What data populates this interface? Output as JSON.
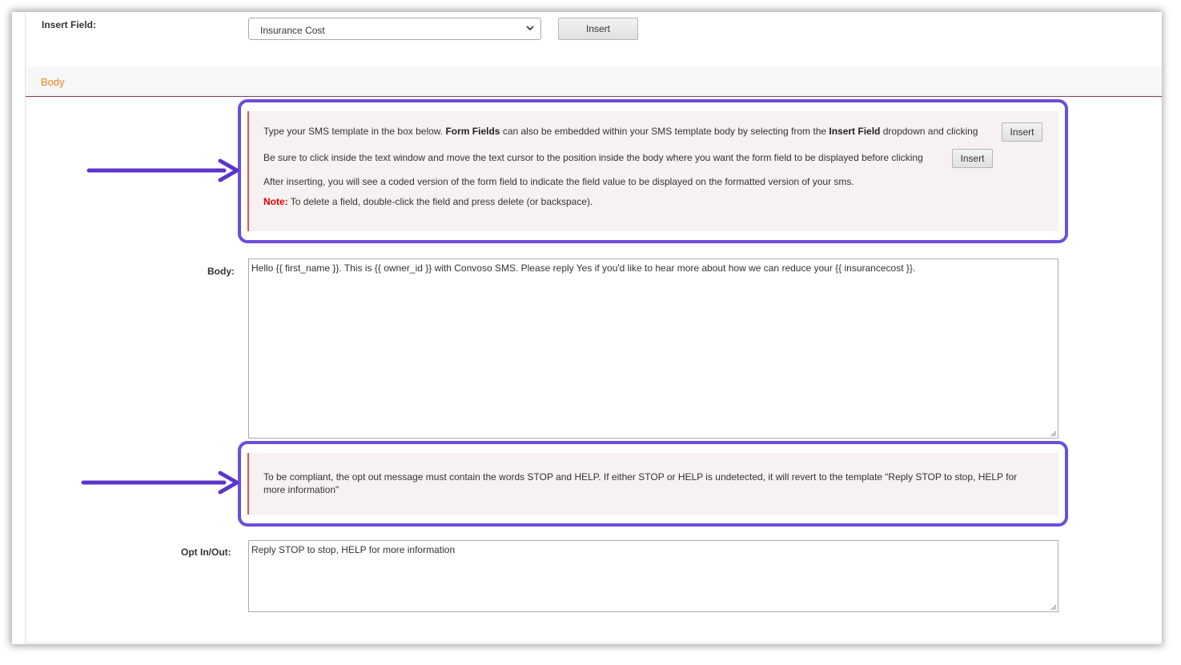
{
  "insert_field": {
    "label": "Insert Field:",
    "selected": "Insurance Cost",
    "button": "Insert"
  },
  "section": {
    "title": "Body"
  },
  "instructions": {
    "line1_a": "Type your SMS template in the box below.  ",
    "line1_b": "Form Fields",
    "line1_c": " can also be embedded within your SMS template body by selecting from the ",
    "line1_d": "Insert Field",
    "line1_e": " dropdown and clicking",
    "line1_button": "Insert",
    "line2": "Be sure to click inside the text window and move the text cursor to the position inside the body where you want the form field to be displayed before clicking",
    "line2_button": "Insert",
    "line3": "After inserting, you will see a coded version of the form field to indicate the field value to be displayed on the formatted version of your sms.",
    "note_label": "Note:",
    "note_text": " To delete a field, double-click the field and press delete (or backspace)."
  },
  "body_field": {
    "label": "Body:",
    "value": "Hello {{ first_name }}. This is {{ owner_id }} with Convoso SMS. Please reply Yes if you'd like to hear more about how we can reduce your {{ insurancecost }}."
  },
  "compliance": {
    "line1": "To be compliant, the opt out message must contain the words STOP and HELP. If either STOP or HELP is undetected, it will revert to the template “Reply STOP to stop, HELP for",
    "line2": "more information\""
  },
  "optin_field": {
    "label": "Opt In/Out:",
    "value": "Reply STOP to stop, HELP for more information"
  },
  "colors": {
    "accent_orange": "#e8851a",
    "callout_purple": "#6b4fd8",
    "note_red": "#e60000"
  }
}
